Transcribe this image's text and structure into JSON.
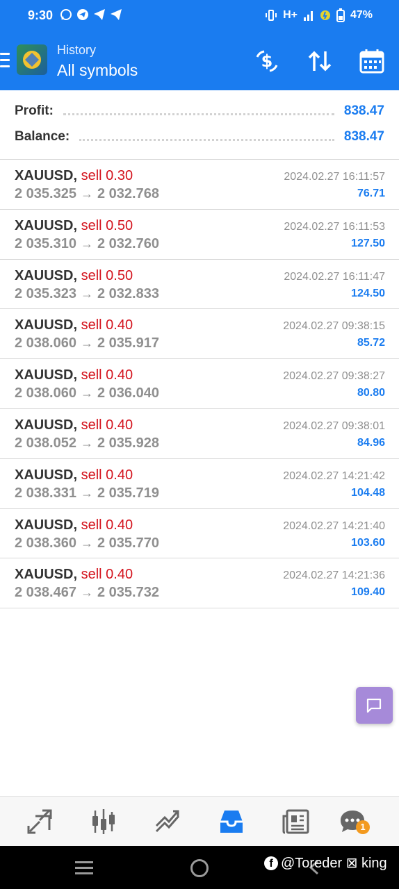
{
  "status_bar": {
    "time": "9:30",
    "network": "H+",
    "battery": "47%"
  },
  "header": {
    "subtitle": "History",
    "title": "All symbols"
  },
  "summary": {
    "profit_label": "Profit:",
    "profit_value": "838.47",
    "balance_label": "Balance:",
    "balance_value": "838.47"
  },
  "trades": [
    {
      "symbol": "XAUUSD,",
      "side": "sell 0.30",
      "open": "2 035.325",
      "close": "2 032.768",
      "time": "2024.02.27 16:11:57",
      "profit": "76.71"
    },
    {
      "symbol": "XAUUSD,",
      "side": "sell 0.50",
      "open": "2 035.310",
      "close": "2 032.760",
      "time": "2024.02.27 16:11:53",
      "profit": "127.50"
    },
    {
      "symbol": "XAUUSD,",
      "side": "sell 0.50",
      "open": "2 035.323",
      "close": "2 032.833",
      "time": "2024.02.27 16:11:47",
      "profit": "124.50"
    },
    {
      "symbol": "XAUUSD,",
      "side": "sell 0.40",
      "open": "2 038.060",
      "close": "2 035.917",
      "time": "2024.02.27 09:38:15",
      "profit": "85.72"
    },
    {
      "symbol": "XAUUSD,",
      "side": "sell 0.40",
      "open": "2 038.060",
      "close": "2 036.040",
      "time": "2024.02.27 09:38:27",
      "profit": "80.80"
    },
    {
      "symbol": "XAUUSD,",
      "side": "sell 0.40",
      "open": "2 038.052",
      "close": "2 035.928",
      "time": "2024.02.27 09:38:01",
      "profit": "84.96"
    },
    {
      "symbol": "XAUUSD,",
      "side": "sell 0.40",
      "open": "2 038.331",
      "close": "2 035.719",
      "time": "2024.02.27 14:21:42",
      "profit": "104.48"
    },
    {
      "symbol": "XAUUSD,",
      "side": "sell 0.40",
      "open": "2 038.360",
      "close": "2 035.770",
      "time": "2024.02.27 14:21:40",
      "profit": "103.60"
    },
    {
      "symbol": "XAUUSD,",
      "side": "sell 0.40",
      "open": "2 038.467",
      "close": "2 035.732",
      "time": "2024.02.27 14:21:36",
      "profit": "109.40"
    }
  ],
  "arrow": "→",
  "bottom_nav": {
    "items": [
      "quotes-icon",
      "chart-icon",
      "trade-icon",
      "history-icon",
      "news-icon",
      "messages-icon"
    ],
    "active": "history-icon",
    "messages_badge": "1"
  },
  "watermark": {
    "text": "@Toreder ⊠ king"
  },
  "colors": {
    "accent": "#1a7cf0",
    "sell": "#d4141e",
    "muted": "#8f8f8f",
    "chat_button": "#a68ad9",
    "badge": "#f39a1f"
  }
}
